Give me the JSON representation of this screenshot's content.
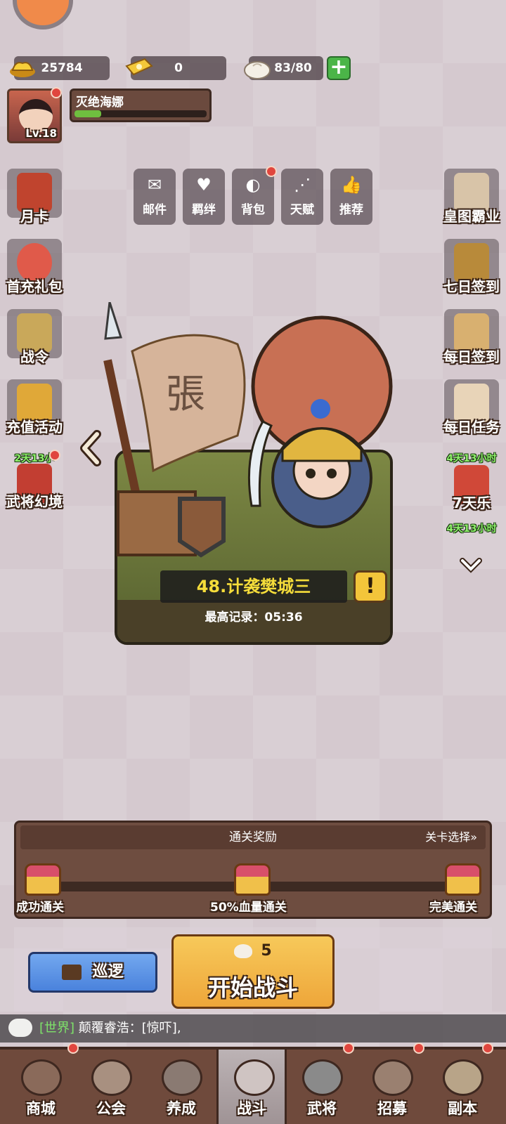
{
  "resources": {
    "gold": "25784",
    "tickets": "0",
    "stamina": "83/80"
  },
  "player": {
    "name": "灭绝海娜",
    "level": "Lv.18",
    "xp_fraction": 0.2
  },
  "toolbar": [
    {
      "label": "邮件",
      "icon": "mail-icon"
    },
    {
      "label": "羁绊",
      "icon": "heart-icon"
    },
    {
      "label": "背包",
      "icon": "bag-icon"
    },
    {
      "label": "天赋",
      "icon": "talent-icon"
    },
    {
      "label": "推荐",
      "icon": "thumbs-up-icon"
    }
  ],
  "left_menu": [
    {
      "label": "月卡"
    },
    {
      "label": "首充礼包"
    },
    {
      "label": "战令"
    },
    {
      "label": "充值活动"
    },
    {
      "label": "武将幻境",
      "timer": "2天13小"
    }
  ],
  "right_menu": [
    {
      "label": "皇图霸业"
    },
    {
      "label": "七日签到"
    },
    {
      "label": "每日签到"
    },
    {
      "label": "每日任务"
    },
    {
      "label": "7天乐",
      "timer": "4天13小时"
    },
    {
      "label": "",
      "timer": "4天13小时"
    }
  ],
  "stage": {
    "name": "48.计袭樊城三",
    "alert": "!",
    "record": "最高记录：05:36"
  },
  "rewards": {
    "title": "通关奖励",
    "stage_select": "关卡选择»",
    "tiers": [
      "成功通关",
      "50%血量通关",
      "完美通关"
    ]
  },
  "actions": {
    "patrol": "巡逻",
    "cost": "5",
    "start": "开始战斗"
  },
  "chat": {
    "channel": "[世界]",
    "message": "颠覆睿浩：[惊吓],"
  },
  "nav": [
    "商城",
    "公会",
    "养成",
    "战斗",
    "武将",
    "招募",
    "副本"
  ],
  "colors": {
    "accent_green": "#7ee36a",
    "start_button": "#f3b848",
    "patrol_button": "#5b93e6",
    "notice_red": "#e0463e"
  }
}
